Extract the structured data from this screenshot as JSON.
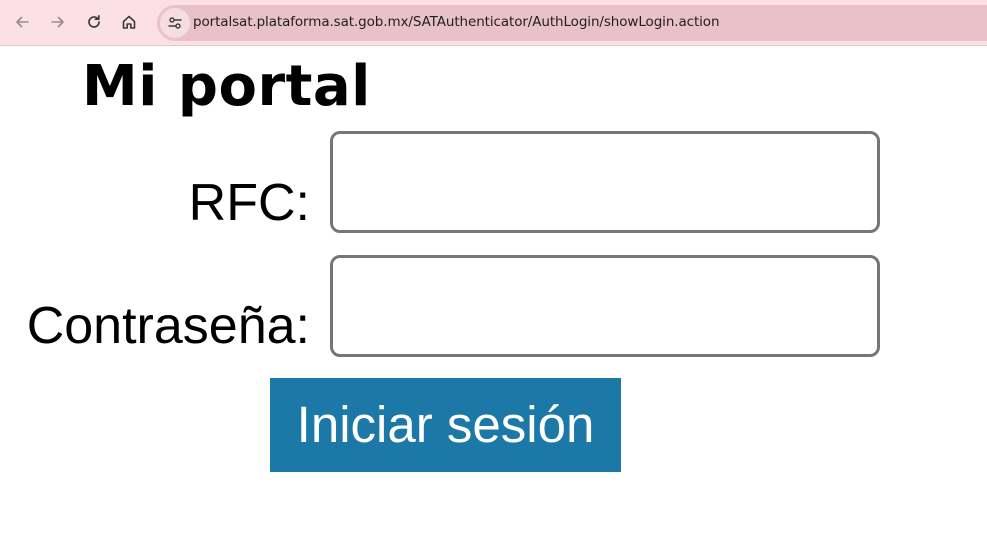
{
  "browser": {
    "url": "portalsat.plataforma.sat.gob.mx/SATAuthenticator/AuthLogin/showLogin.action",
    "icons": [
      "back-arrow-icon",
      "forward-arrow-icon",
      "reload-icon",
      "home-icon",
      "site-info-icon"
    ]
  },
  "page": {
    "title": "Mi portal"
  },
  "form": {
    "rfc_label": "RFC:",
    "rfc_value": "",
    "password_label": "Contraseña:",
    "password_value": "",
    "submit_label": "Iniciar sesión"
  },
  "colors": {
    "toolbar_bg": "#fbe0e6",
    "omnibox_bg": "#e9c2c9",
    "button_bg": "#1b78a7",
    "input_border": "#767676"
  }
}
